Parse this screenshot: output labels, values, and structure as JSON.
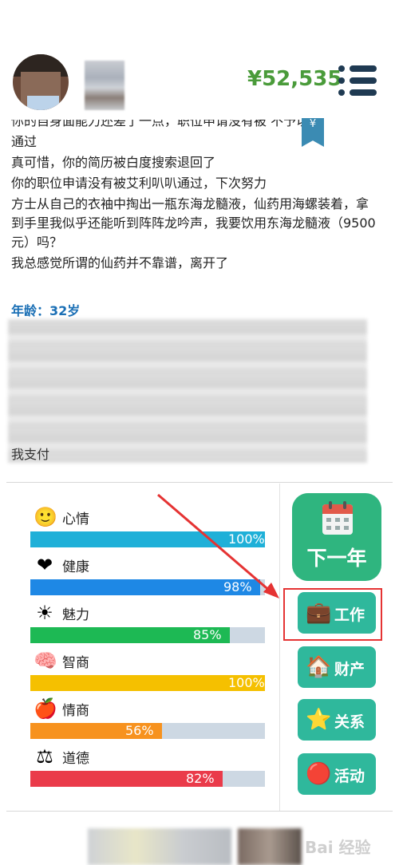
{
  "header": {
    "money": "¥52,535"
  },
  "log": {
    "lines": [
      "你的自身面能力还差了一点，职位申请没有被      不予以",
      "通过",
      "真可惜，你的简历被白度搜索退回了",
      "你的职位申请没有被艾利叭叭通过，下次努力",
      "方士从自己的衣袖中掏出一瓶东海龙髓液，仙药用海螺装着，拿到手里我似乎还能听到阵阵龙吟声，我要饮用东海龙髓液（9500元）吗？",
      "我总感觉所谓的仙药并不靠谱，离开了"
    ],
    "bookmark": "¥"
  },
  "profile": {
    "age_label": "年龄：32岁",
    "tail_text": "我支付"
  },
  "stats": [
    {
      "name": "心情",
      "icon": "smiley-icon",
      "glyph": "🙂",
      "value": 100,
      "label": "100%",
      "color": "#1fb0d8"
    },
    {
      "name": "健康",
      "icon": "heart-icon",
      "glyph": "❤",
      "value": 98,
      "label": "98%",
      "color": "#1e88e5"
    },
    {
      "name": "魅力",
      "icon": "sun-icon",
      "glyph": "☀",
      "value": 85,
      "label": "85%",
      "color": "#1db954"
    },
    {
      "name": "智商",
      "icon": "brain-icon",
      "glyph": "🧠",
      "value": 100,
      "label": "100%",
      "color": "#f5c000"
    },
    {
      "name": "情商",
      "icon": "apple-icon",
      "glyph": "🍎",
      "value": 56,
      "label": "56%",
      "color": "#f7921e"
    },
    {
      "name": "道德",
      "icon": "scales-icon",
      "glyph": "⚖",
      "value": 82,
      "label": "82%",
      "color": "#ea3b4a"
    }
  ],
  "actions": {
    "next_year": "下一年",
    "work": "工作",
    "property": "财产",
    "relations": "关系",
    "activities": "活动"
  },
  "colors": {
    "accent_green": "#2fb57f",
    "button_teal": "#2fb89c",
    "money_green": "#4a9b3a",
    "highlight_red": "#e53333"
  },
  "watermark": "Bai 经验"
}
